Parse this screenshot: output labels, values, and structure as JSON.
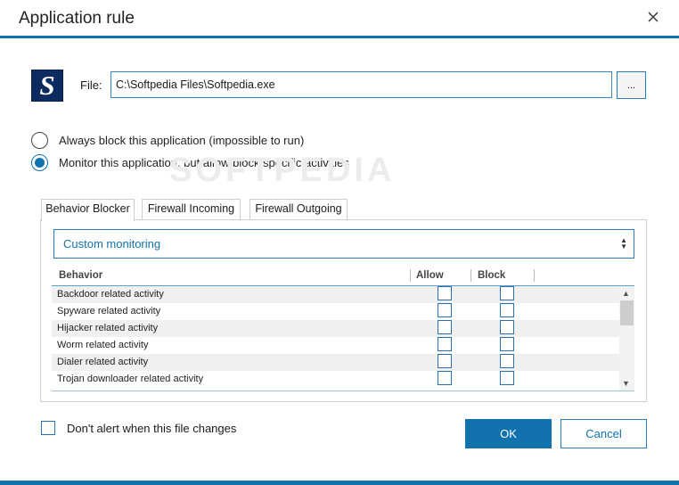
{
  "window": {
    "title": "Application rule"
  },
  "file": {
    "label": "File:",
    "value": "C:\\Softpedia Files\\Softpedia.exe",
    "browse_label": "...",
    "logo_letter": "S"
  },
  "options": [
    {
      "label": "Always block this application (impossible to run)",
      "selected": false
    },
    {
      "label": "Monitor this application, but allow/block specific activities",
      "selected": true
    }
  ],
  "watermark": "SOFTPEDIA",
  "tabs": [
    {
      "label": "Behavior Blocker",
      "active": true
    },
    {
      "label": "Firewall Incoming",
      "active": false
    },
    {
      "label": "Firewall Outgoing",
      "active": false
    }
  ],
  "monitoring": {
    "selected": "Custom monitoring"
  },
  "table": {
    "columns": [
      "Behavior",
      "Allow",
      "Block"
    ],
    "rows": [
      {
        "behavior": "Backdoor related activity",
        "allow": false,
        "block": false
      },
      {
        "behavior": "Spyware related activity",
        "allow": false,
        "block": false
      },
      {
        "behavior": "Hijacker related activity",
        "allow": false,
        "block": false
      },
      {
        "behavior": "Worm related activity",
        "allow": false,
        "block": false
      },
      {
        "behavior": "Dialer related activity",
        "allow": false,
        "block": false
      },
      {
        "behavior": "Trojan downloader related activity",
        "allow": false,
        "block": false
      }
    ]
  },
  "footer": {
    "no_alert_label": "Don't alert when this file changes",
    "no_alert_checked": false,
    "ok_label": "OK",
    "cancel_label": "Cancel"
  },
  "colors": {
    "accent": "#1172ad"
  }
}
